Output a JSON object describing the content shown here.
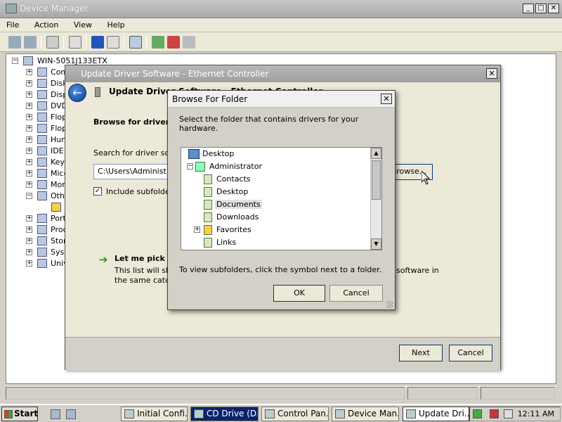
{
  "device_manager": {
    "title": "Device Manager",
    "menu": [
      "File",
      "Action",
      "View",
      "Help"
    ],
    "tree": {
      "root": "WIN-5051J133ETX",
      "items": [
        "Com",
        "Disk",
        "Disp",
        "DVD",
        "Flop",
        "Flop",
        "Hum",
        "IDE",
        "Key",
        "Mice",
        "Mon",
        "Oth",
        "",
        "Port",
        "Proc",
        "Stor",
        "Syst",
        "Univ"
      ]
    }
  },
  "wizard": {
    "title": "Update Driver Software - Ethernet Controller",
    "heading": "Update Driver Software - Ethernet Controller",
    "browse_heading": "Browse for driver s",
    "search_label": "Search for driver sof",
    "path_value": "C:\\Users\\Administ",
    "browse_button": "Browse...",
    "include_subfolders": "Include subfolde",
    "pick_title": "Let me pick fr",
    "pick_desc_1": "This list will show",
    "pick_desc_2": "the same categ",
    "pick_desc_right": "software in",
    "next_button": "Next",
    "cancel_button": "Cancel"
  },
  "browse_for_folder": {
    "title": "Browse For Folder",
    "instruction": "Select the folder that contains drivers for your hardware.",
    "folders": [
      {
        "label": "Desktop",
        "level": 0,
        "expander": "",
        "selected": false
      },
      {
        "label": "Administrator",
        "level": 1,
        "expander": "−",
        "selected": false
      },
      {
        "label": "Contacts",
        "level": 2,
        "expander": "",
        "selected": false
      },
      {
        "label": "Desktop",
        "level": 2,
        "expander": "",
        "selected": false
      },
      {
        "label": "Documents",
        "level": 2,
        "expander": "",
        "selected": true
      },
      {
        "label": "Downloads",
        "level": 2,
        "expander": "",
        "selected": false
      },
      {
        "label": "Favorites",
        "level": 2,
        "expander": "+",
        "selected": false
      },
      {
        "label": "Links",
        "level": 2,
        "expander": "",
        "selected": false
      }
    ],
    "note": "To view subfolders, click the symbol next to a folder.",
    "ok_button": "OK",
    "cancel_button": "Cancel"
  },
  "taskbar": {
    "start": "Start",
    "tasks": [
      {
        "label": "Initial Confi...",
        "state": "normal"
      },
      {
        "label": "CD Drive (D...",
        "state": "dark"
      },
      {
        "label": "Control Pan...",
        "state": "normal"
      },
      {
        "label": "Device Man...",
        "state": "normal"
      },
      {
        "label": "Update Dri...",
        "state": "active"
      }
    ],
    "clock": "12:11 AM"
  }
}
